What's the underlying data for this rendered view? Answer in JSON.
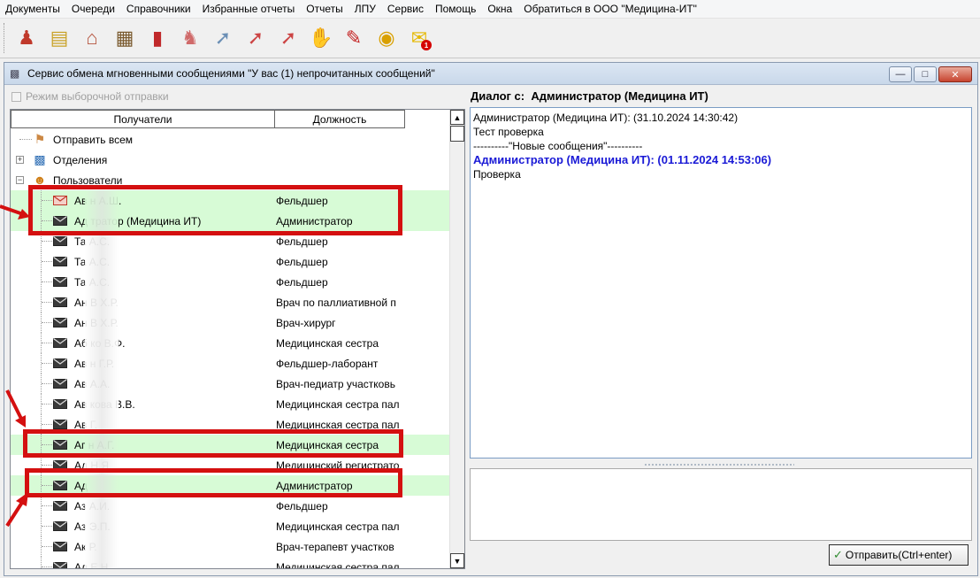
{
  "menu": [
    "Документы",
    "Очереди",
    "Справочники",
    "Избранные отчеты",
    "Отчеты",
    "ЛПУ",
    "Сервис",
    "Помощь",
    "Окна",
    "Обратиться в ООО \"Медицина-ИТ\""
  ],
  "toolbar": {
    "icons": [
      "doctor-icon",
      "schedule-icon",
      "hospital-icon",
      "cabinet-icon",
      "book-icon",
      "nurse-icon",
      "syringe-icon",
      "thermometer-icon",
      "thermometer-icon",
      "medical-record-icon",
      "pdf-icon",
      "lock-icon",
      "chat-icon"
    ],
    "chat_badge": "1"
  },
  "window": {
    "title": "Сервис обмена мгновенными сообщениями \"У вас (1) непрочитанных сообщений\""
  },
  "left": {
    "checkbox_label": "Режим выборочной отправки",
    "columns": [
      "Получатели",
      "Должность"
    ],
    "nodes": [
      {
        "label": "Отправить всем",
        "icon": "group-send-icon"
      },
      {
        "label": "Отделения",
        "icon": "departments-icon",
        "expander": "+"
      },
      {
        "label": "Пользователи",
        "icon": "users-icon",
        "expander": "−"
      }
    ],
    "users": [
      {
        "name": "Ав         н А.Ш.",
        "position": "Фельдшер",
        "highlight": true
      },
      {
        "name": "Ад           тратор (Медицина ИТ)",
        "position": "Администратор",
        "highlight": true
      },
      {
        "name": "Та          А.С.",
        "position": "Фельдшер",
        "highlight": false
      },
      {
        "name": "Та          А.С.",
        "position": "Фельдшер",
        "highlight": false
      },
      {
        "name": "Та          А.С.",
        "position": "Фельдшер",
        "highlight": false
      },
      {
        "name": "Ан          В Х.Р.",
        "position": "Врач по паллиативной п",
        "highlight": false
      },
      {
        "name": "Ан          В Х.Р.",
        "position": "Врач-хирург",
        "highlight": false
      },
      {
        "name": "Аб          ко В.Ф.",
        "position": "Медицинская сестра",
        "highlight": false
      },
      {
        "name": "Ав          н Г.Р.",
        "position": "Фельдшер-лаборант",
        "highlight": false
      },
      {
        "name": "Ав          А.А.",
        "position": "Врач-педиатр участковь",
        "highlight": false
      },
      {
        "name": "Ав          кова В.В.",
        "position": "Медицинская сестра пал",
        "highlight": false
      },
      {
        "name": "Ав          Г.",
        "position": "Медицинская сестра пал",
        "highlight": false
      },
      {
        "name": "Аг          н А.Г.",
        "position": "Медицинская сестра",
        "highlight": true
      },
      {
        "name": "Ад          Н.Я.",
        "position": "Медицинский регистрато",
        "highlight": false
      },
      {
        "name": "Ад",
        "position": "Администратор",
        "highlight": true
      },
      {
        "name": "Аз          А.И.",
        "position": "Фельдшер",
        "highlight": false
      },
      {
        "name": "Аз          Э.П.",
        "position": "Медицинская сестра пал",
        "highlight": false
      },
      {
        "name": "Ак          Р.",
        "position": "Врач-терапевт участков",
        "highlight": false
      },
      {
        "name": "Ал          Е.Н.",
        "position": "Медицинская сестра пал",
        "highlight": false
      }
    ]
  },
  "right": {
    "dialog_prefix": "Диалог с:",
    "dialog_with": "Администратор (Медицина ИТ)",
    "messages": [
      {
        "text": "Администратор (Медицина ИТ): (31.10.2024 14:30:42)",
        "style": "normal"
      },
      {
        "text": "Тест проверка",
        "style": "normal"
      },
      {
        "text": "----------\"Новые сообщения\"----------",
        "style": "normal"
      },
      {
        "text": "Администратор (Медицина ИТ): (01.11.2024 14:53:06)",
        "style": "bold-blue"
      },
      {
        "text": "Проверка",
        "style": "normal"
      }
    ],
    "send_label": "Отправить(Ctrl+enter)"
  },
  "colors": {
    "highlight": "#d7fbd6",
    "annotation": "#d41010",
    "new_message": "#1a1ad6"
  }
}
